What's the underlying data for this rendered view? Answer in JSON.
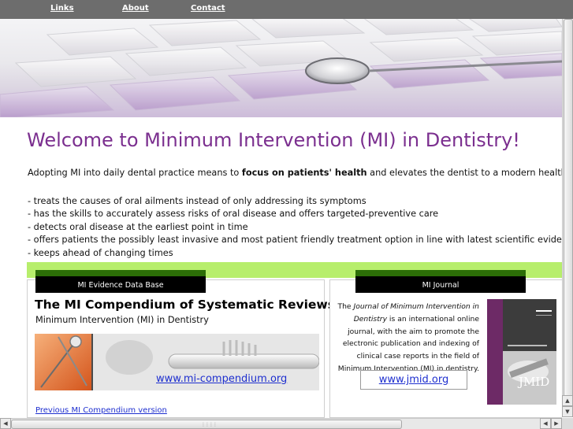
{
  "nav": {
    "links_label": "Links",
    "about_label": "About",
    "contact_label": "Contact"
  },
  "main": {
    "welcome": "Welcome to Minimum Intervention (MI) in Dentistry!",
    "intro_before": "Adopting MI into daily dental practice means to ",
    "intro_bold": "focus on patients' health",
    "intro_after": " and elevates the dentist to a modern health care profe",
    "points": [
      "- treats the causes of oral ailments instead of only addressing its symptoms",
      "- has the skills to accurately assess risks of oral disease and offers targeted-preventive care",
      "- detects oral disease at the earliest point in time",
      "- offers patients the possibly least invasive and most patient friendly treatment option in line with latest scientific evidence",
      "- keeps ahead of changing times"
    ]
  },
  "box_database": {
    "tab": "MI Evidence Data Base",
    "title": "The MI Compendium of Systematic Reviews",
    "subtitle": "Minimum Intervention (MI) in Dentistry",
    "link": "www.mi-compendium.org",
    "previous_link": "Previous MI Compendium version"
  },
  "box_journal": {
    "tab": "MI Journal",
    "text_before": "The ",
    "text_italic": "Journal of Minimum Intervention in Dentistry",
    "text_after": " is an international online journal, with the aim to promote the electronic publication and indexing of clinical case reports in the field of Minimum Intervention (MI) in dentistry.",
    "link": "www.jmid.org",
    "cover_label": "JMID"
  },
  "colors": {
    "nav_bg": "#6d6d6d",
    "headline": "#7b2f8f",
    "accent_green": "#b7ee6c",
    "tab_green": "#2c6e07",
    "link": "#1e2fcf"
  }
}
